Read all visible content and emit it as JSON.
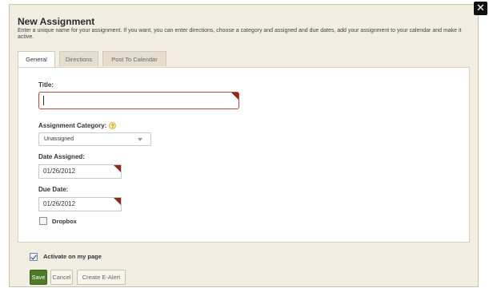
{
  "dialog": {
    "title": "New Assignment",
    "description": "Enter a unique name for your assignment. If you want, you can enter directions, choose a category and assigned and due dates, add your assignment to your calendar and make it active.",
    "close_glyph": "✕"
  },
  "tabs": [
    {
      "label": "General",
      "active": true
    },
    {
      "label": "Directions",
      "active": false
    },
    {
      "label": "Post To Calendar",
      "active": false
    }
  ],
  "form": {
    "title_label": "Title:",
    "title_value": "",
    "category_label": "Assignment Category:",
    "category_help": "?",
    "category_value": "Unassigned",
    "date_assigned_label": "Date Assigned:",
    "date_assigned_value": "01/26/2012",
    "due_date_label": "Due Date:",
    "due_date_value": "01/26/2012",
    "dropbox_label": "Dropbox",
    "dropbox_checked": false
  },
  "footer": {
    "activate_label": "Activate on my page",
    "activate_checked": true,
    "save_label": "Save",
    "cancel_label": "Cancel",
    "create_alert_label": "Create E-Alert"
  },
  "colors": {
    "dialog_bg": "#f1ede1",
    "required_accent": "#8c2a1c",
    "save_green": "#4f7a2a"
  }
}
